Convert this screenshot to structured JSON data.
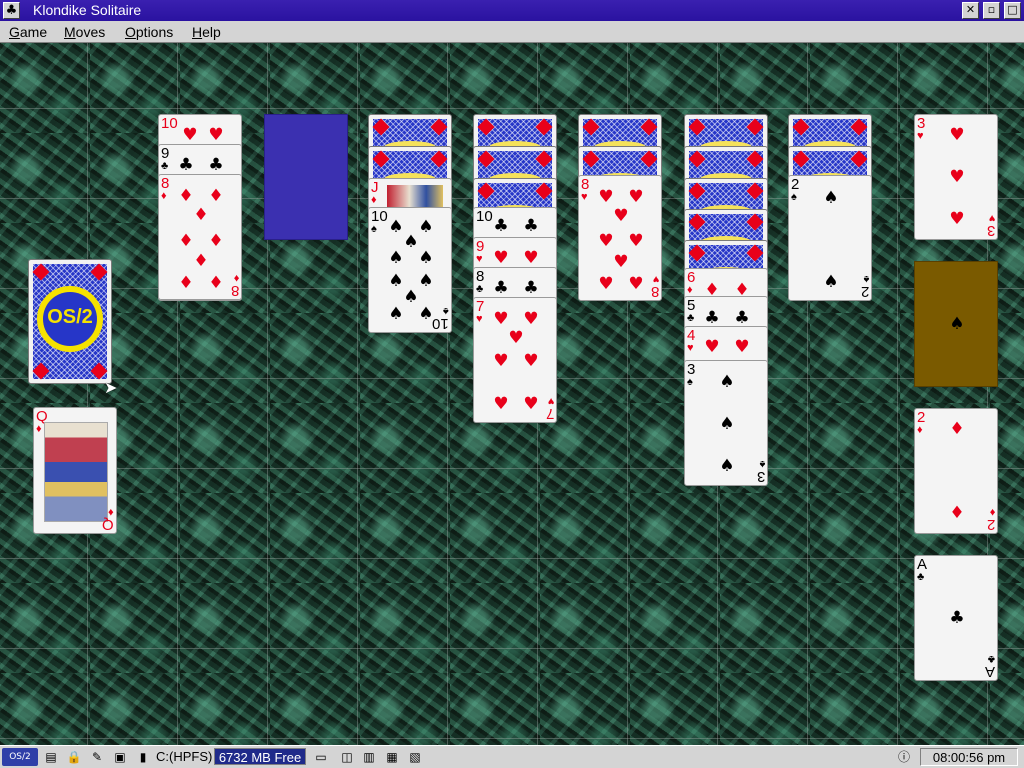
{
  "window": {
    "title": "Klondike Solitaire",
    "sys_icon": "♣",
    "buttons": [
      "close-button-icon",
      "minimize-icon",
      "maximize-icon"
    ]
  },
  "menu": [
    "Game",
    "Moves",
    "Options",
    "Help"
  ],
  "stock": {
    "logo_text": "OS/2",
    "logo_bg": "#2636c8",
    "logo_ring": "#f5e200"
  },
  "waste": {
    "rank": "Q",
    "suit": "♦",
    "face": "queen-of-diamonds"
  },
  "waste_fan": [
    {
      "rank": "10",
      "suit": "♥"
    },
    {
      "rank": "9",
      "suit": "♣"
    },
    {
      "rank": "8",
      "suit": "♦"
    }
  ],
  "tableau": [
    {
      "hidden": 0,
      "face_up": []
    },
    {
      "hidden": 2,
      "face_up": [
        {
          "rank": "J",
          "suit": "♦",
          "face": "jack-of-diamonds"
        },
        {
          "rank": "10",
          "suit": "♠"
        }
      ]
    },
    {
      "hidden": 3,
      "face_up": [
        {
          "rank": "10",
          "suit": "♣"
        },
        {
          "rank": "9",
          "suit": "♥"
        },
        {
          "rank": "8",
          "suit": "♣"
        },
        {
          "rank": "7",
          "suit": "♥"
        }
      ]
    },
    {
      "hidden": 2,
      "face_up": [
        {
          "rank": "8",
          "suit": "♥"
        }
      ]
    },
    {
      "hidden": 5,
      "face_up": [
        {
          "rank": "6",
          "suit": "♦"
        },
        {
          "rank": "5",
          "suit": "♣"
        },
        {
          "rank": "4",
          "suit": "♥"
        },
        {
          "rank": "3",
          "suit": "♠"
        }
      ]
    },
    {
      "hidden": 2,
      "face_up": [
        {
          "rank": "2",
          "suit": "♠"
        }
      ]
    }
  ],
  "foundations": [
    {
      "rank": "3",
      "suit": "♥"
    },
    {
      "empty": true,
      "suit": "♠",
      "color": "#7a5a00"
    },
    {
      "rank": "2",
      "suit": "♦"
    },
    {
      "rank": "A",
      "suit": "♣"
    }
  ],
  "taskbar": {
    "drive": "C:(HPFS)",
    "free": "6732 MB Free",
    "clock": "08:00:56 pm"
  }
}
